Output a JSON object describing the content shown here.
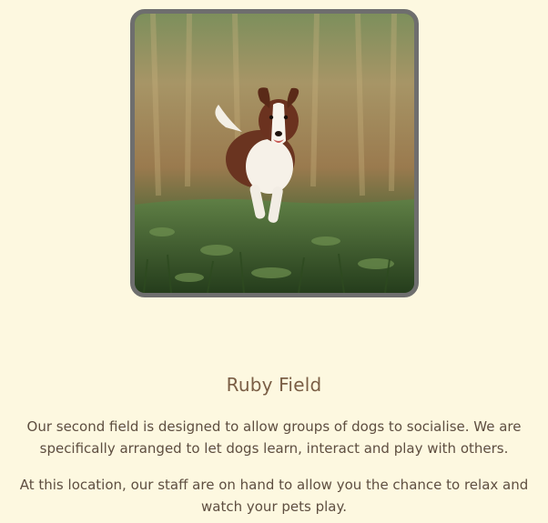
{
  "card": {
    "image_alt": "Brown and white dog running through a grassy field",
    "title": "Ruby Field",
    "paragraphs": [
      "Our second field is designed to allow groups of dogs to socialise. We are specifically arranged to let dogs learn, interact and play with others.",
      "At this location, our staff are on hand to allow you the chance to relax and watch your pets play."
    ]
  },
  "colors": {
    "page_background": "#fdf8e0",
    "frame_border": "#6e6e6e",
    "title_text": "#7a5e45",
    "body_text": "#5e4e40"
  }
}
